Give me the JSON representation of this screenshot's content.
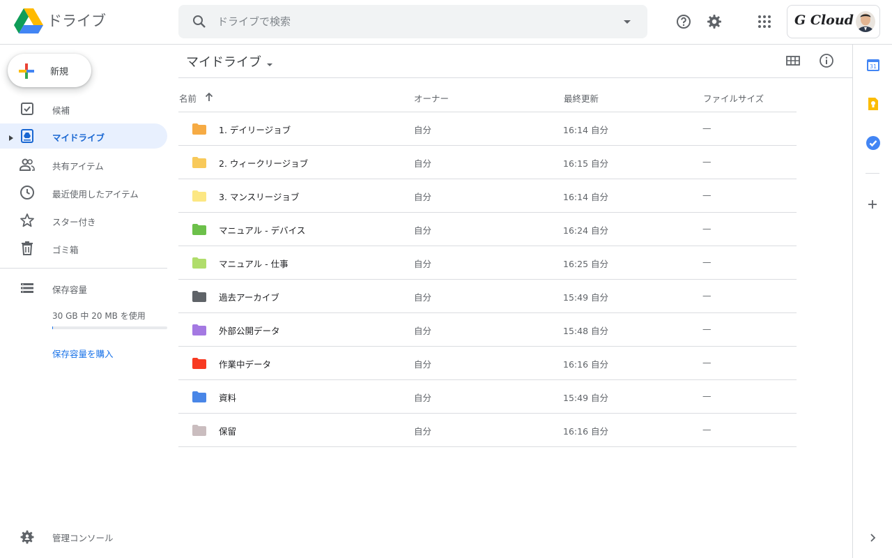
{
  "app": {
    "title": "ドライブ"
  },
  "search": {
    "placeholder": "ドライブで検索"
  },
  "account": {
    "brand_text": "G Cloud"
  },
  "sidebar": {
    "new_label": "新規",
    "items": [
      {
        "label": "候補",
        "icon": "check-box-icon"
      },
      {
        "label": "マイドライブ",
        "icon": "my-drive-icon",
        "active": true
      },
      {
        "label": "共有アイテム",
        "icon": "people-icon"
      },
      {
        "label": "最近使用したアイテム",
        "icon": "clock-icon"
      },
      {
        "label": "スター付き",
        "icon": "star-icon"
      },
      {
        "label": "ゴミ箱",
        "icon": "trash-icon"
      }
    ],
    "storage": {
      "label": "保存容量",
      "usage": "30 GB 中 20 MB を使用",
      "used_fraction": 0.0007,
      "buy_label": "保存容量を購入"
    },
    "admin_label": "管理コンソール"
  },
  "main": {
    "title": "マイドライブ",
    "columns": {
      "name": "名前",
      "owner": "オーナー",
      "modified": "最終更新",
      "size": "ファイルサイズ"
    },
    "rows": [
      {
        "name": "1. デイリージョブ",
        "owner": "自分",
        "modified": "16:14 自分",
        "size": "—",
        "color": "#f6ab44"
      },
      {
        "name": "2. ウィークリージョブ",
        "owner": "自分",
        "modified": "16:15 自分",
        "size": "—",
        "color": "#f8c95a"
      },
      {
        "name": "3. マンスリージョブ",
        "owner": "自分",
        "modified": "16:14 自分",
        "size": "—",
        "color": "#fce783"
      },
      {
        "name": "マニュアル - デバイス",
        "owner": "自分",
        "modified": "16:24 自分",
        "size": "—",
        "color": "#6cc04a"
      },
      {
        "name": "マニュアル - 仕事",
        "owner": "自分",
        "modified": "16:25 自分",
        "size": "—",
        "color": "#b0dd6b"
      },
      {
        "name": "過去アーカイブ",
        "owner": "自分",
        "modified": "15:49 自分",
        "size": "—",
        "color": "#5f6368"
      },
      {
        "name": "外部公開データ",
        "owner": "自分",
        "modified": "15:48 自分",
        "size": "—",
        "color": "#a479e2"
      },
      {
        "name": "作業中データ",
        "owner": "自分",
        "modified": "16:16 自分",
        "size": "—",
        "color": "#f83a22"
      },
      {
        "name": "資料",
        "owner": "自分",
        "modified": "15:49 自分",
        "size": "—",
        "color": "#4986e7"
      },
      {
        "name": "保留",
        "owner": "自分",
        "modified": "16:16 自分",
        "size": "—",
        "color": "#cabdbf"
      }
    ]
  },
  "side_panel": {
    "calendar_day": "31"
  }
}
